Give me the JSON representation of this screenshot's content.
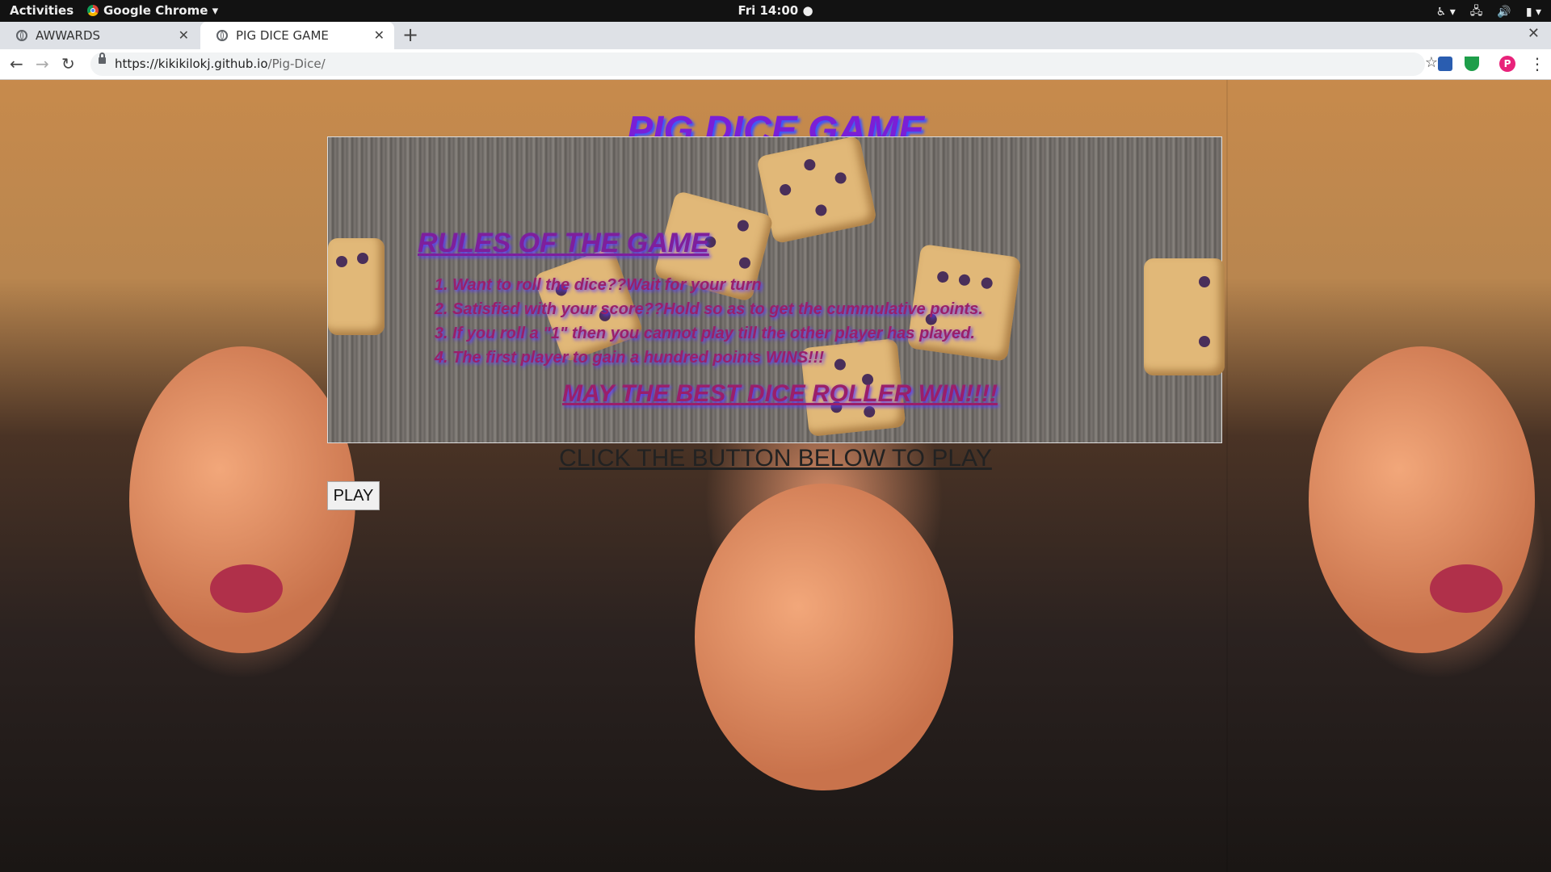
{
  "system_bar": {
    "activities": "Activities",
    "app_name": "Google Chrome ▾",
    "clock": "Fri 14:00 ●"
  },
  "tabs": [
    {
      "label": "AWWARDS",
      "active": false
    },
    {
      "label": "PIG DICE GAME",
      "active": true
    }
  ],
  "address_bar": {
    "url_host": "https://kikikilokj.github.io",
    "url_path": "/Pig-Dice/"
  },
  "profile_initial": "P",
  "page": {
    "title": "PIG DICE GAME",
    "rules_heading": "RULES OF THE GAME",
    "rules": [
      "Want to roll the dice??Wait for your turn",
      "Satisfied with your score??Hold so as to get the cummulative points.",
      "If you roll a \"1\" then you cannot play till the other player has played.",
      "The first player to gain a hundred points WINS!!!"
    ],
    "motto": "MAY THE BEST DICE ROLLER WIN!!!!",
    "cta": "CLICK THE BUTTON BELOW TO PLAY",
    "play_button": "PLAY"
  }
}
